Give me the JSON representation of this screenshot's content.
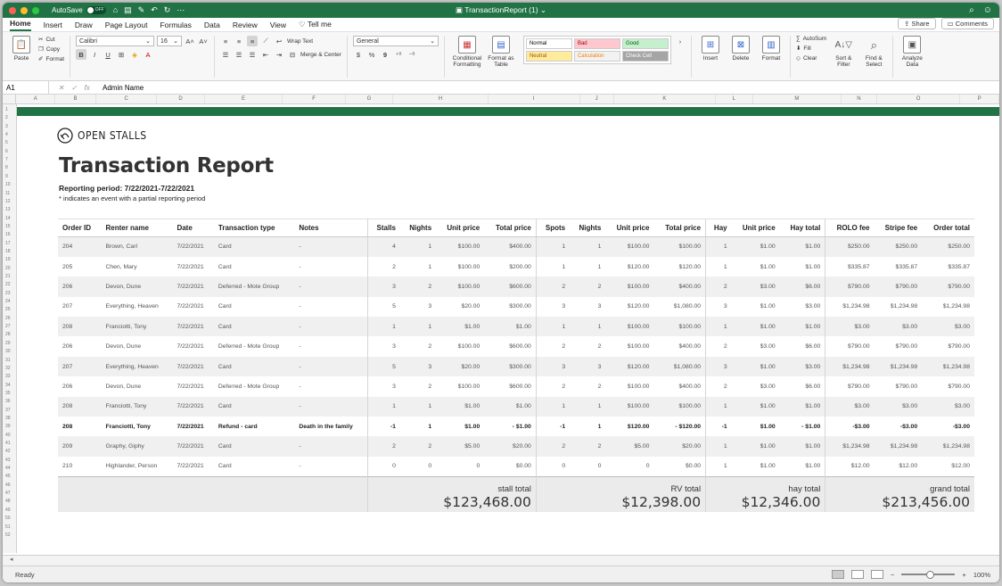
{
  "titlebar": {
    "autosave_label": "AutoSave",
    "autosave_state": "OFF",
    "doc_title": "TransactionReport (1)",
    "qa_icons": [
      "home-icon",
      "save-icon",
      "edit-icon",
      "undo-icon",
      "redo-icon",
      "more-icon"
    ]
  },
  "ribbon_tabs": [
    "Home",
    "Insert",
    "Draw",
    "Page Layout",
    "Formulas",
    "Data",
    "Review",
    "View",
    "Tell me"
  ],
  "ribbon_right": {
    "share": "Share",
    "comments": "Comments"
  },
  "ribbon": {
    "paste": "Paste",
    "cut": "Cut",
    "copy": "Copy",
    "format": "Format",
    "font_name": "Calibri",
    "font_size": "16",
    "bold": "B",
    "italic": "I",
    "underline": "U",
    "wrap_text": "Wrap Text",
    "merge_center": "Merge & Center",
    "number_format": "General",
    "currency": "$",
    "percent": "%",
    "comma": "9",
    "conditional": "Conditional Formatting",
    "format_table": "Format as Table",
    "styles": [
      {
        "label": "Normal",
        "bg": "#ffffff",
        "fg": "#000000"
      },
      {
        "label": "Bad",
        "bg": "#ffc7ce",
        "fg": "#9c0006"
      },
      {
        "label": "Good",
        "bg": "#c6efce",
        "fg": "#006100"
      },
      {
        "label": "Neutral",
        "bg": "#ffeb9c",
        "fg": "#9c5700"
      },
      {
        "label": "Calculation",
        "bg": "#f2f2f2",
        "fg": "#fa7d00"
      },
      {
        "label": "Check Cell",
        "bg": "#a5a5a5",
        "fg": "#ffffff"
      }
    ],
    "insert": "Insert",
    "delete": "Delete",
    "format_cells": "Format",
    "autosum": "AutoSum",
    "fill": "Fill",
    "clear": "Clear",
    "sort_filter": "Sort & Filter",
    "find_select": "Find & Select",
    "analyze": "Analyze Data"
  },
  "formula_bar": {
    "name_box": "A1",
    "fx": "fx",
    "value": "Admin Name"
  },
  "columns": [
    "A",
    "B",
    "C",
    "D",
    "E",
    "F",
    "G",
    "H",
    "I",
    "J",
    "K",
    "L",
    "M",
    "N",
    "O",
    "P"
  ],
  "report": {
    "logo_text": "OPEN STALLS",
    "title": "Transaction Report",
    "period": "Reporting period: 7/22/2021-7/22/2021",
    "note": "* indicates an event with a partial reporting period",
    "headers": [
      "Order ID",
      "Renter name",
      "Date",
      "Transaction type",
      "Notes",
      "Stalls",
      "Nights",
      "Unit price",
      "Total price",
      "Spots",
      "Nights",
      "Unit price",
      "Total price",
      "Hay",
      "Unit price",
      "Hay total",
      "ROLO fee",
      "Stripe fee",
      "Order total"
    ],
    "rows": [
      [
        "204",
        "Brown, Carl",
        "7/22/2021",
        "Card",
        "-",
        "4",
        "1",
        "$100.00",
        "$400.00",
        "1",
        "1",
        "$100.00",
        "$100.00",
        "1",
        "$1.00",
        "$1.00",
        "$250.00",
        "$250.00",
        "$250.00"
      ],
      [
        "205",
        "Chen, Mary",
        "7/22/2021",
        "Card",
        "-",
        "2",
        "1",
        "$100.00",
        "$200.00",
        "1",
        "1",
        "$120.00",
        "$120.00",
        "1",
        "$1.00",
        "$1.00",
        "$335.87",
        "$335.87",
        "$335.87"
      ],
      [
        "206",
        "Devon, Dune",
        "7/22/2021",
        "Deferred - Mote Group",
        "-",
        "3",
        "2",
        "$100.00",
        "$600.00",
        "2",
        "2",
        "$100.00",
        "$400.00",
        "2",
        "$3.00",
        "$6.00",
        "$790.00",
        "$790.00",
        "$790.00"
      ],
      [
        "207",
        "Everything, Heaven",
        "7/22/2021",
        "Card",
        "-",
        "5",
        "3",
        "$20.00",
        "$300.00",
        "3",
        "3",
        "$120.00",
        "$1,080.00",
        "3",
        "$1.00",
        "$3.00",
        "$1,234.98",
        "$1,234.98",
        "$1,234.98"
      ],
      [
        "208",
        "Franciotti, Tony",
        "7/22/2021",
        "Card",
        "-",
        "1",
        "1",
        "$1.00",
        "$1.00",
        "1",
        "1",
        "$100.00",
        "$100.00",
        "1",
        "$1.00",
        "$1.00",
        "$3.00",
        "$3.00",
        "$3.00"
      ],
      [
        "206",
        "Devon, Dune",
        "7/22/2021",
        "Deferred - Mote Group",
        "-",
        "3",
        "2",
        "$100.00",
        "$600.00",
        "2",
        "2",
        "$100.00",
        "$400.00",
        "2",
        "$3.00",
        "$6.00",
        "$790.00",
        "$790.00",
        "$790.00"
      ],
      [
        "207",
        "Everything, Heaven",
        "7/22/2021",
        "Card",
        "-",
        "5",
        "3",
        "$20.00",
        "$300.00",
        "3",
        "3",
        "$120.00",
        "$1,080.00",
        "3",
        "$1.00",
        "$3.00",
        "$1,234.98",
        "$1,234.98",
        "$1,234.98"
      ],
      [
        "206",
        "Devon, Dune",
        "7/22/2021",
        "Deferred - Mote Group",
        "-",
        "3",
        "2",
        "$100.00",
        "$600.00",
        "2",
        "2",
        "$100.00",
        "$400.00",
        "2",
        "$3.00",
        "$6.00",
        "$790.00",
        "$790.00",
        "$790.00"
      ],
      [
        "208",
        "Franciotti, Tony",
        "7/22/2021",
        "Card",
        "-",
        "1",
        "1",
        "$1.00",
        "$1.00",
        "1",
        "1",
        "$100.00",
        "$100.00",
        "1",
        "$1.00",
        "$1.00",
        "$3.00",
        "$3.00",
        "$3.00"
      ],
      [
        "208",
        "Franciotti, Tony",
        "7/22/2021",
        "Refund - card",
        "Death in the family",
        "-1",
        "1",
        "$1.00",
        "- $1.00",
        "-1",
        "1",
        "$120.00",
        "- $120.00",
        "-1",
        "$1.00",
        "- $1.00",
        "-$3.00",
        "-$3.00",
        "-$3.00"
      ],
      [
        "209",
        "Graphy, Giphy",
        "7/22/2021",
        "Card",
        "-",
        "2",
        "2",
        "$5.00",
        "$20.00",
        "2",
        "2",
        "$5.00",
        "$20.00",
        "1",
        "$1.00",
        "$1.00",
        "$1,234.98",
        "$1,234.98",
        "$1,234.98"
      ],
      [
        "210",
        "Highlander, Person",
        "7/22/2021",
        "Card",
        "-",
        "0",
        "0",
        "0",
        "$0.00",
        "0",
        "0",
        "0",
        "$0.00",
        "1",
        "$1.00",
        "$1.00",
        "$12.00",
        "$12.00",
        "$12.00"
      ]
    ],
    "totals": {
      "stall_label": "stall total",
      "stall_value": "$123,468.00",
      "rv_label": "RV total",
      "rv_value": "$12,398.00",
      "hay_label": "hay total",
      "hay_value": "$12,346.00",
      "grand_label": "grand total",
      "grand_value": "$213,456.00"
    }
  },
  "status": {
    "ready": "Ready",
    "zoom": "100%",
    "zoom_minus": "−",
    "zoom_plus": "+"
  },
  "colors": {
    "excel_green": "#217346"
  }
}
